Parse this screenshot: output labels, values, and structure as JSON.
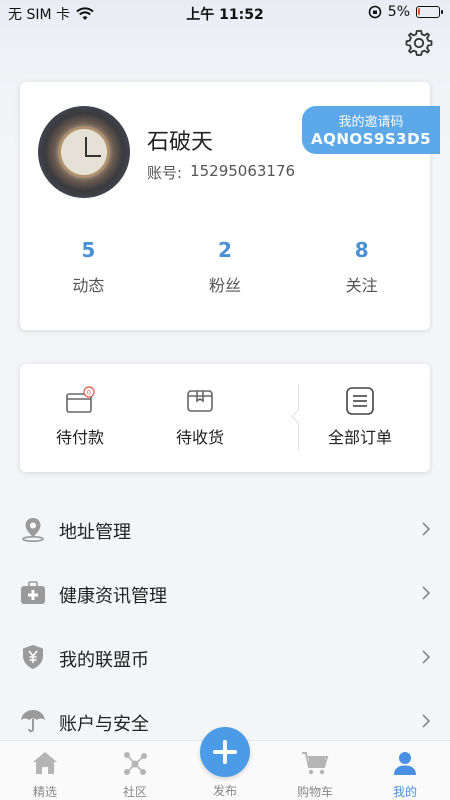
{
  "status_bar": {
    "carrier": "无 SIM 卡",
    "time": "上午 11:52",
    "battery": "5%",
    "battery_level": 0.05
  },
  "profile": {
    "name": "石破天",
    "account_label": "账号:",
    "account": "15295063176",
    "invite_label": "我的邀请码",
    "invite_code": "AQNOS9S3D5",
    "stats": [
      {
        "value": "5",
        "label": "动态"
      },
      {
        "value": "2",
        "label": "粉丝"
      },
      {
        "value": "8",
        "label": "关注"
      }
    ]
  },
  "orders": {
    "pending_payment": {
      "label": "待付款",
      "badge": "0"
    },
    "pending_receipt": {
      "label": "待收货"
    },
    "all_orders": {
      "label": "全部订单"
    }
  },
  "menu": [
    {
      "label": "地址管理",
      "icon": "location-pin-icon"
    },
    {
      "label": "健康资讯管理",
      "icon": "medical-kit-icon"
    },
    {
      "label": "我的联盟币",
      "icon": "yuan-shield-icon"
    },
    {
      "label": "账户与安全",
      "icon": "umbrella-icon"
    }
  ],
  "bottom_nav": {
    "home": "精选",
    "community": "社区",
    "publish": "发布",
    "cart": "购物车",
    "mine": "我的"
  },
  "colors": {
    "accent": "#4a90e2",
    "stat_number": "#4a90d6",
    "invite_bg": "#5da8e8"
  }
}
